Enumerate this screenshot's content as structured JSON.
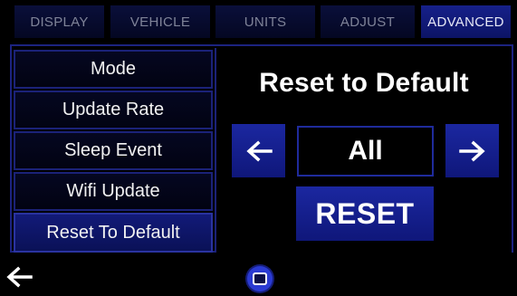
{
  "tabs": [
    {
      "label": "DISPLAY",
      "active": false
    },
    {
      "label": "VEHICLE",
      "active": false
    },
    {
      "label": "UNITS",
      "active": false
    },
    {
      "label": "ADJUST",
      "active": false
    },
    {
      "label": "ADVANCED",
      "active": true
    }
  ],
  "menu": {
    "items": [
      {
        "label": "Mode",
        "selected": false
      },
      {
        "label": "Update Rate",
        "selected": false
      },
      {
        "label": "Sleep Event",
        "selected": false
      },
      {
        "label": "Wifi Update",
        "selected": false
      },
      {
        "label": "Reset To Default",
        "selected": true
      }
    ]
  },
  "panel": {
    "title": "Reset to Default",
    "value": "All",
    "reset_label": "RESET",
    "prev_icon": "left-arrow-icon",
    "next_icon": "right-arrow-icon"
  },
  "bottom": {
    "back_icon": "back-arrow-icon",
    "home_icon": "home-icon"
  },
  "colors": {
    "accent": "#1b27a0",
    "active_tab": "#16208a",
    "border": "#1b2278",
    "background": "#000000"
  }
}
